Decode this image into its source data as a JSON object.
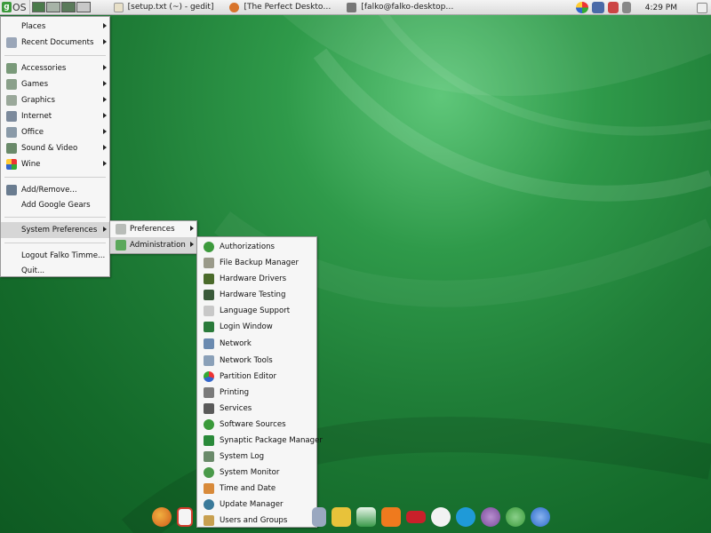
{
  "panel": {
    "os_label": "OS",
    "tasks": [
      {
        "title": "[setup.txt (~) - gedit]",
        "icon": "text-editor-icon",
        "color": "#e8e0c8"
      },
      {
        "title": "[The Perfect Deskto…",
        "icon": "firefox-icon",
        "color": "#d8742c"
      },
      {
        "title": "[falko@falko-desktop…",
        "icon": "terminal-icon",
        "color": "#777777"
      }
    ],
    "clock": "4:29 PM"
  },
  "main_menu": {
    "items": [
      {
        "label": "Places",
        "icon": "",
        "submenu": true
      },
      {
        "label": "Recent Documents",
        "icon": "recent-documents-icon",
        "submenu": true
      },
      {
        "label": "Accessories",
        "icon": "accessories-icon",
        "submenu": true
      },
      {
        "label": "Games",
        "icon": "games-icon",
        "submenu": true
      },
      {
        "label": "Graphics",
        "icon": "graphics-icon",
        "submenu": true
      },
      {
        "label": "Internet",
        "icon": "internet-icon",
        "submenu": true
      },
      {
        "label": "Office",
        "icon": "office-icon",
        "submenu": true
      },
      {
        "label": "Sound & Video",
        "icon": "sound-video-icon",
        "submenu": true
      },
      {
        "label": "Wine",
        "icon": "wine-icon",
        "submenu": true
      },
      {
        "label": "Add/Remove...",
        "icon": "add-remove-icon",
        "submenu": false
      },
      {
        "label": "Add Google Gears",
        "icon": "",
        "submenu": false
      },
      {
        "label": "System Preferences",
        "icon": "",
        "submenu": true
      },
      {
        "label": "Logout Falko Timme...",
        "icon": "",
        "submenu": false
      },
      {
        "label": "Quit...",
        "icon": "",
        "submenu": false
      }
    ]
  },
  "system_preferences_menu": {
    "items": [
      {
        "label": "Preferences",
        "icon": "preferences-icon"
      },
      {
        "label": "Administration",
        "icon": "administration-icon"
      }
    ]
  },
  "administration_menu": {
    "items": [
      {
        "label": "Authorizations",
        "icon": "authorizations-icon"
      },
      {
        "label": "File Backup Manager",
        "icon": "file-backup-icon"
      },
      {
        "label": "Hardware Drivers",
        "icon": "hardware-drivers-icon"
      },
      {
        "label": "Hardware Testing",
        "icon": "hardware-testing-icon"
      },
      {
        "label": "Language Support",
        "icon": "language-support-icon"
      },
      {
        "label": "Login Window",
        "icon": "login-window-icon"
      },
      {
        "label": "Network",
        "icon": "network-icon"
      },
      {
        "label": "Network Tools",
        "icon": "network-tools-icon"
      },
      {
        "label": "Partition Editor",
        "icon": "partition-editor-icon"
      },
      {
        "label": "Printing",
        "icon": "printer-icon"
      },
      {
        "label": "Services",
        "icon": "services-icon"
      },
      {
        "label": "Software Sources",
        "icon": "software-sources-icon"
      },
      {
        "label": "Synaptic Package Manager",
        "icon": "synaptic-icon"
      },
      {
        "label": "System Log",
        "icon": "system-log-icon"
      },
      {
        "label": "System Monitor",
        "icon": "system-monitor-icon"
      },
      {
        "label": "Time and Date",
        "icon": "time-date-icon"
      },
      {
        "label": "Update Manager",
        "icon": "update-manager-icon"
      },
      {
        "label": "Users and Groups",
        "icon": "users-groups-icon"
      }
    ]
  },
  "dock": {
    "items": [
      {
        "icon": "firefox-icon",
        "color": "#e07a22"
      },
      {
        "icon": "gmail-icon",
        "color": "#d23c2c"
      },
      {
        "icon": "scanner-icon",
        "color": "#9aa8c0"
      },
      {
        "icon": "shopping-bag-icon",
        "color": "#e8c23a"
      },
      {
        "icon": "picasa-icon",
        "color": "#3a9a4a"
      },
      {
        "icon": "blogger-icon",
        "color": "#ef7a1e"
      },
      {
        "icon": "youtube-icon",
        "color": "#c8202a"
      },
      {
        "icon": "chat-icon",
        "color": "#f2f2f2"
      },
      {
        "icon": "skype-icon",
        "color": "#1f9ad8"
      },
      {
        "icon": "openoffice-impress-icon",
        "color": "#7a4a9a"
      },
      {
        "icon": "openoffice-calc-icon",
        "color": "#3a9a3a"
      },
      {
        "icon": "openoffice-writer-icon",
        "color": "#2a6ac8"
      }
    ]
  }
}
